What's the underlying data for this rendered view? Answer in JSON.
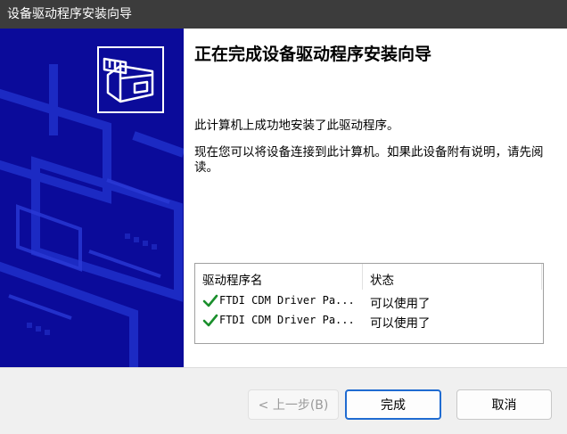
{
  "window": {
    "title": "设备驱动程序安装向导"
  },
  "wizard": {
    "heading": "正在完成设备驱动程序安装向导",
    "message1": "此计算机上成功地安装了此驱动程序。",
    "message2": "现在您可以将设备连接到此计算机。如果此设备附有说明，请先阅读。"
  },
  "driver_list": {
    "columns": [
      "驱动程序名",
      "状态"
    ],
    "rows": [
      {
        "name": "FTDI CDM Driver Pa...",
        "status": "可以使用了"
      },
      {
        "name": "FTDI CDM Driver Pa...",
        "status": "可以使用了"
      }
    ]
  },
  "buttons": {
    "back": "< 上一步(B)",
    "finish": "完成",
    "cancel": "取消"
  },
  "colors": {
    "sidebar_blue": "#0b0b9a",
    "check_green": "#1a8f2c",
    "focus_blue": "#1f6bd1"
  },
  "icons": [
    "hardware-install-icon",
    "checkmark-icon"
  ]
}
